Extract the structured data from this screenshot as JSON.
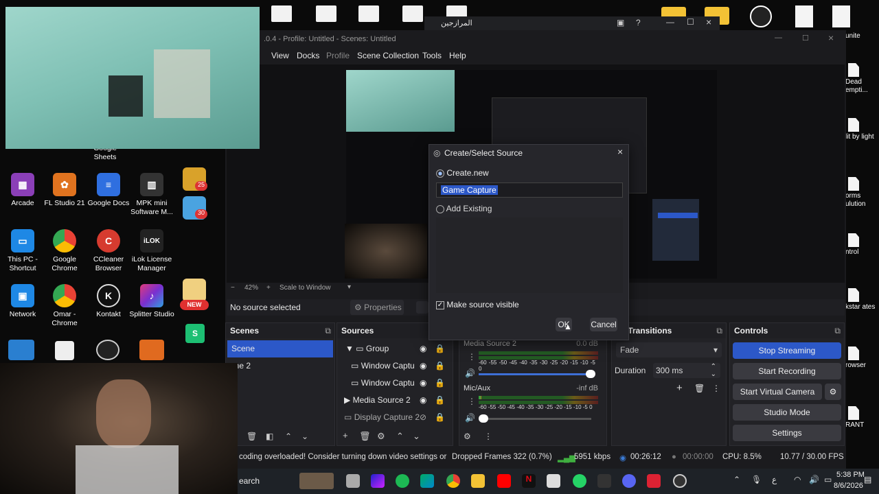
{
  "colors": {
    "accent_blue": "#2c58c8",
    "dock_bg": "#222226",
    "window_bg": "#1b1b1e",
    "meter_green": "#3fae3f",
    "live_icon": "#3a7bd5"
  },
  "desktop": {
    "left_icons": [
      {
        "label": "Arcade",
        "icon": "arcade-icon",
        "color": "#8b3fb8"
      },
      {
        "label": "FL Studio 21",
        "icon": "fl-studio-icon",
        "color": "#e0731f"
      },
      {
        "label": "Google Docs",
        "icon": "google-docs-icon",
        "color": "#2f6fe0"
      },
      {
        "label": "MPK mini Software M...",
        "icon": "mpk-mini-icon",
        "color": "#333333"
      },
      {
        "label": "This PC - Shortcut",
        "icon": "this-pc-icon",
        "color": "#1e88e5"
      },
      {
        "label": "Google Chrome",
        "icon": "chrome-icon",
        "color": "#e94235"
      },
      {
        "label": "CCleaner Browser",
        "icon": "ccleaner-browser-icon",
        "color": "#d63b2f"
      },
      {
        "label": "iLok License Manager",
        "icon": "ilok-icon",
        "color": "#222222"
      },
      {
        "label": "Network",
        "icon": "network-icon",
        "color": "#1e88e5"
      },
      {
        "label": "Omar - Chrome",
        "icon": "chrome-icon",
        "color": "#e94235"
      },
      {
        "label": "Kontakt",
        "icon": "kontakt-icon",
        "color": "#111111"
      },
      {
        "label": "Splitter Studio",
        "icon": "splitter-studio-icon",
        "color": "#7a2fd0"
      }
    ],
    "top_row_labels": [
      "Google Sheets"
    ],
    "right_files": [
      "Dead empti...",
      "lit by light",
      "orms ulution",
      "ntrol",
      "kstar ates",
      "rowser",
      "RANT"
    ],
    "right_top_label": "unite",
    "side_badges": [
      "25",
      "30",
      "NEW"
    ]
  },
  "obs": {
    "title": ".0.4 - Profile: Untitled - Scenes: Untitled",
    "menu": [
      "View",
      "Docks",
      "Profile",
      "Scene Collection",
      "Tools",
      "Help"
    ],
    "preview_bar": {
      "zoom": "42%",
      "scale_mode": "Scale to Window"
    },
    "no_source_text": "No source selected",
    "properties_label": "Properties",
    "docks": {
      "scenes": {
        "title": "Scenes",
        "items": [
          "Scene",
          "ene 2"
        ]
      },
      "sources": {
        "title": "Sources",
        "items": [
          {
            "label": "Group",
            "icon": "group-folder-icon",
            "visible": true
          },
          {
            "label": "Window Captu",
            "icon": "window-capture-icon",
            "visible": true
          },
          {
            "label": "Window Captu",
            "icon": "window-capture-icon",
            "visible": true
          },
          {
            "label": "Media Source 2",
            "icon": "media-source-icon",
            "visible": true
          },
          {
            "label": "Display Capture 2",
            "icon": "display-capture-icon",
            "visible": false
          }
        ]
      },
      "audio": {
        "channels": [
          {
            "name": "Media Source 2",
            "db": "0.0 dB",
            "level": 0.0
          },
          {
            "name": "Mic/Aux",
            "db": "-inf dB",
            "level": 0.02
          }
        ],
        "scale": [
          "-60",
          "-55",
          "-50",
          "-45",
          "-40",
          "-35",
          "-30",
          "-25",
          "-20",
          "-15",
          "-10",
          "-5",
          "0"
        ]
      },
      "transitions": {
        "title": "ne Transitions",
        "selected": "Fade",
        "duration_label": "Duration",
        "duration_value": "300 ms"
      },
      "controls": {
        "title": "Controls",
        "buttons": [
          "Stop Streaming",
          "Start Recording",
          "Start Virtual Camera",
          "Studio Mode",
          "Settings"
        ]
      }
    },
    "status": {
      "warning": "coding overloaded! Consider turning down video settings or",
      "dropped": "Dropped Frames 322 (0.7%)",
      "bitrate": "5951 kbps",
      "live_time": "00:26:12",
      "rec_time": "00:00:00",
      "cpu": "CPU: 8.5%",
      "fps": "10.77 / 30.00 FPS"
    },
    "embedded_title": "المرازجين"
  },
  "dialog": {
    "title": "Create/Select Source",
    "create_new_label": "Create.new",
    "name_value": "Game Capture",
    "add_existing_label": "Add Existing",
    "make_visible_label": "Make source visible",
    "make_visible_checked": true,
    "ok_label": "OK",
    "cancel_label": "Cancel"
  },
  "taskbar": {
    "search_label": "earch",
    "time": "5:38 PM",
    "date": "8/6/2026",
    "lang": "ع"
  }
}
